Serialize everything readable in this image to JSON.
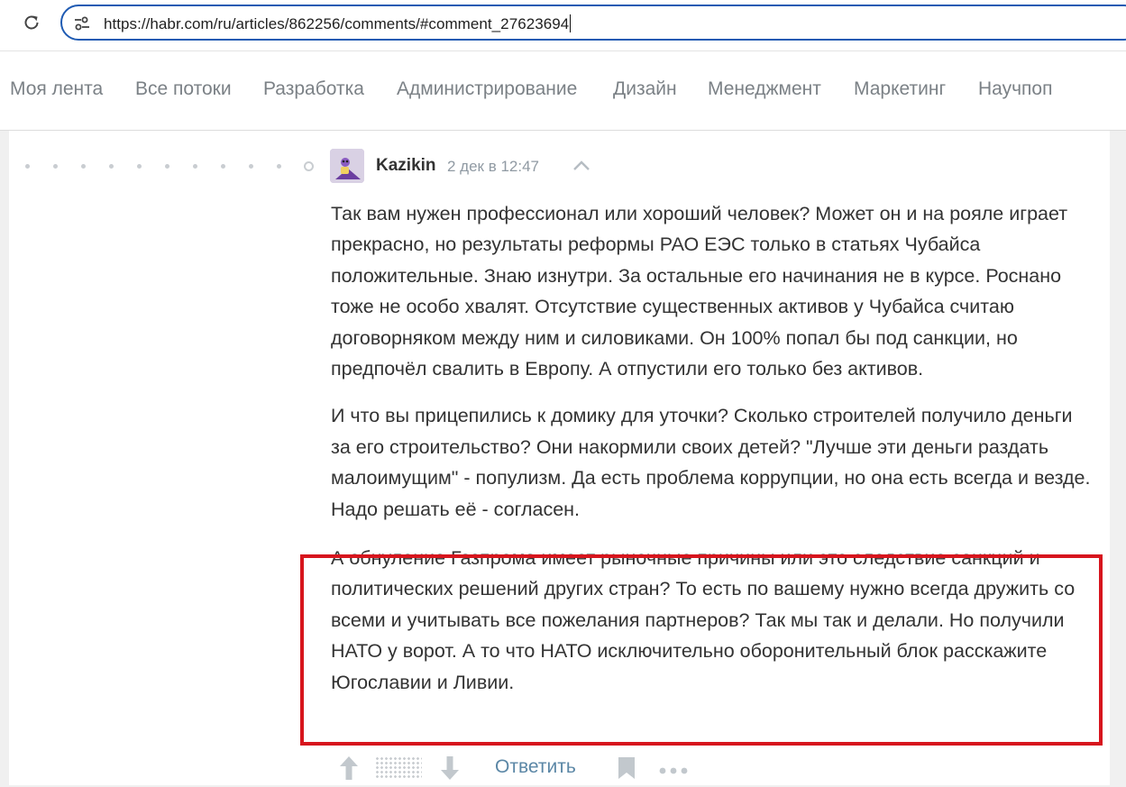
{
  "browser": {
    "url": "https://habr.com/ru/articles/862256/comments/#comment_27623694"
  },
  "nav": {
    "items": [
      "Моя лента",
      "Все потоки",
      "Разработка",
      "Администрирование",
      "Дизайн",
      "Менеджмент",
      "Маркетинг",
      "Научпоп"
    ]
  },
  "comment": {
    "author": "Kazikin",
    "timestamp": "2 дек в 12:47",
    "paragraphs": [
      "Так вам нужен профессионал или хороший человек? Может он и на рояле играет прекрасно, но результаты реформы РАО ЕЭС только в статьях Чубайса положительные. Знаю изнутри. За остальные его начинания не в курсе. Роснано тоже не особо хвалят. Отсутствие существенных активов у Чубайса считаю договорняком между ним и силовиками. Он 100% попал бы под санкции, но предпочёл свалить в Европу. А отпустили его только без активов.",
      "И что вы прицепились к домику для уточки? Сколько строителей получило деньги за его строительство? Они накормили своих детей? \"Лучше эти деньги раздать малоимущим\" - популизм. Да есть проблема коррупции, но она есть всегда и везде. Надо решать её - согласен.",
      "А обнуление Газпрома имеет рыночные причины или это следствие санкций и политических решений других стран? То есть по вашему нужно всегда дружить со всеми и учитывать все пожелания партнеров? Так мы так и делали. Но получили НАТО у ворот. А то что НАТО исключительно оборонительный блок расскажите Югославии и Ливии."
    ],
    "reply_label": "Ответить"
  },
  "colors": {
    "highlight_border": "#d7151d",
    "link": "#5b87a6",
    "address_border": "#1f5bb3"
  },
  "icons": [
    "reload-icon",
    "site-settings-icon",
    "collapse-up-icon",
    "vote-up-icon",
    "vote-down-icon",
    "bookmark-icon",
    "more-icon"
  ]
}
